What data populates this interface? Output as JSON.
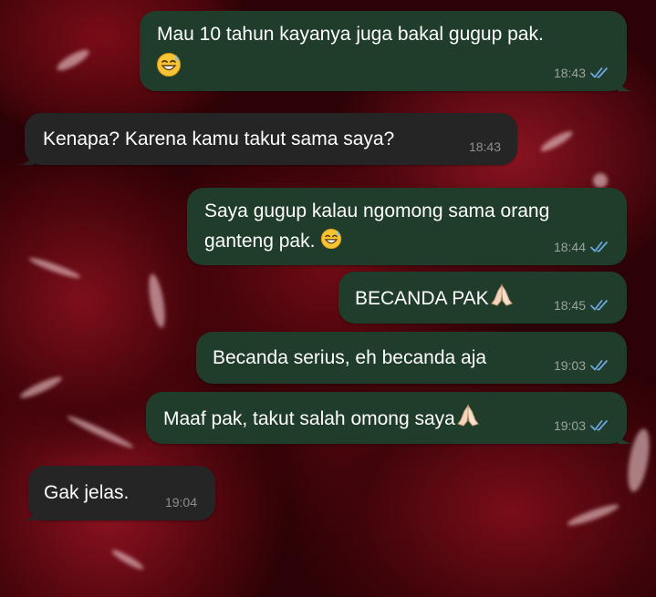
{
  "chat": {
    "messages": [
      {
        "id": 1,
        "direction": "outgoing",
        "text": "Mau 10 tahun kayanya juga bakal gugup pak.",
        "emoji": "sweat-smile",
        "time": "18:43",
        "status": "read"
      },
      {
        "id": 2,
        "direction": "incoming",
        "text": "Kenapa? Karena kamu takut sama saya?",
        "time": "18:43"
      },
      {
        "id": 3,
        "direction": "outgoing",
        "text_line1": "Saya gugup kalau ngomong sama orang",
        "text_line2": "ganteng pak.",
        "emoji": "sweat-smile",
        "time": "18:44",
        "status": "read"
      },
      {
        "id": 4,
        "direction": "outgoing",
        "text": "BECANDA PAK",
        "emoji": "folded-hands",
        "time": "18:45",
        "status": "read"
      },
      {
        "id": 5,
        "direction": "outgoing",
        "text": "Becanda serius, eh becanda aja",
        "time": "19:03",
        "status": "read"
      },
      {
        "id": 6,
        "direction": "outgoing",
        "text": "Maaf pak, takut salah omong saya",
        "emoji": "folded-hands",
        "time": "19:03",
        "status": "read"
      },
      {
        "id": 7,
        "direction": "incoming",
        "text": "Gak jelas.",
        "time": "19:04"
      }
    ]
  },
  "colors": {
    "outgoing_bubble": "#1f3d2a",
    "incoming_bubble": "#252525",
    "read_ticks": "#6fa8e0",
    "timestamp": "#9aa39c",
    "message_text": "#ffffff"
  },
  "icons": {
    "read_receipt": "double-check-icon",
    "emoji_sweat": "sweat-smile-emoji-icon",
    "emoji_pray": "folded-hands-emoji-icon"
  }
}
